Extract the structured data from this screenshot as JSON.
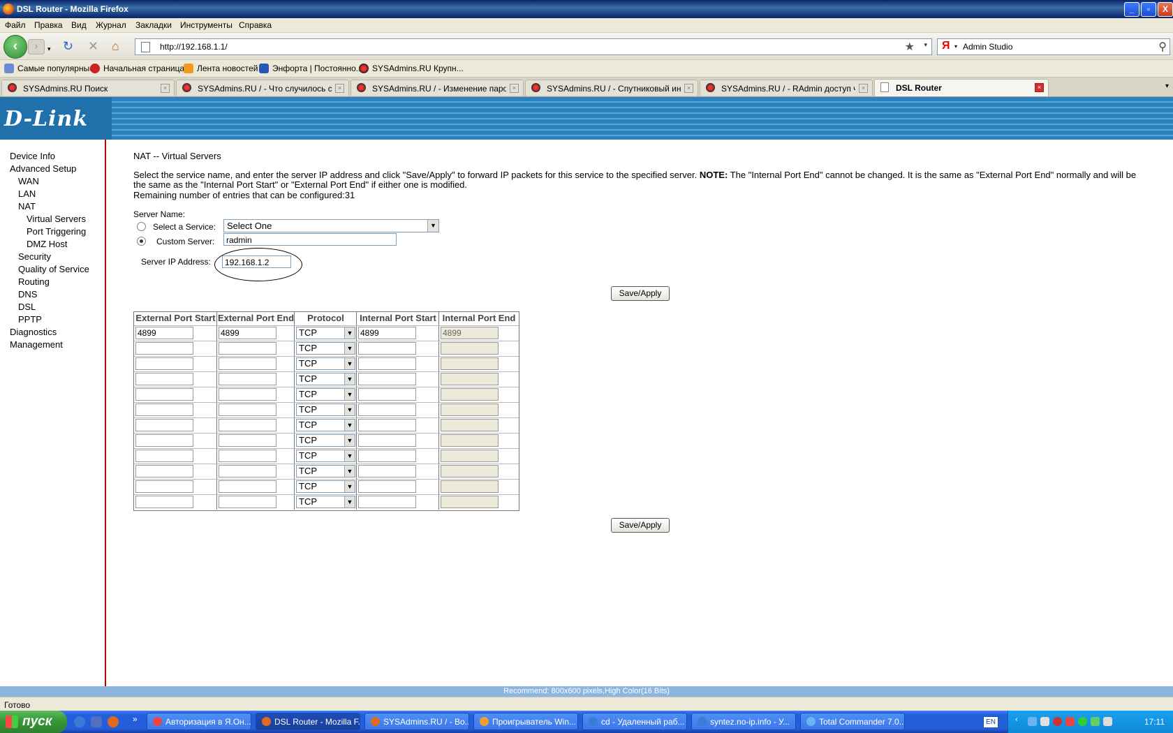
{
  "window": {
    "title": "DSL Router - Mozilla Firefox",
    "min": "_",
    "max": "▫",
    "close": "X"
  },
  "menu": [
    "Файл",
    "Правка",
    "Вид",
    "Журнал",
    "Закладки",
    "Инструменты",
    "Справка"
  ],
  "nav": {
    "url": "http://192.168.1.1/",
    "search_engine": "Я",
    "search_query": "Admin Studio"
  },
  "bookmarks": [
    "Самые популярные",
    "Начальная страница",
    "Лента новостей",
    "Энфорта | Постоянно...",
    "SYSAdmins.RU Крупн..."
  ],
  "tabs": [
    {
      "label": "SYSAdmins.RU Поиск",
      "active": false
    },
    {
      "label": "SYSAdmins.RU / - Что случилось с D...",
      "active": false
    },
    {
      "label": "SYSAdmins.RU / - Изменение пароля ...",
      "active": false
    },
    {
      "label": "SYSAdmins.RU / - Спутниковый интер...",
      "active": false
    },
    {
      "label": "SYSAdmins.RU / - RAdmin доступ чере...",
      "active": false
    },
    {
      "label": "DSL Router",
      "active": true
    }
  ],
  "brand": "D-Link",
  "sidebar": [
    {
      "label": "Device Info",
      "level": 0
    },
    {
      "label": "Advanced Setup",
      "level": 0
    },
    {
      "label": "WAN",
      "level": 1
    },
    {
      "label": "LAN",
      "level": 1
    },
    {
      "label": "NAT",
      "level": 1
    },
    {
      "label": "Virtual Servers",
      "level": 2
    },
    {
      "label": "Port Triggering",
      "level": 2
    },
    {
      "label": "DMZ Host",
      "level": 2
    },
    {
      "label": "Security",
      "level": 1
    },
    {
      "label": "Quality of Service",
      "level": 1
    },
    {
      "label": "Routing",
      "level": 1
    },
    {
      "label": "DNS",
      "level": 1
    },
    {
      "label": "DSL",
      "level": 1
    },
    {
      "label": "PPTP",
      "level": 1
    },
    {
      "label": "Diagnostics",
      "level": 0
    },
    {
      "label": "Management",
      "level": 0
    }
  ],
  "page": {
    "title": "NAT -- Virtual Servers",
    "intro": "Select the service name, and enter the server IP address and click \"Save/Apply\" to forward IP packets for this service to the specified server.",
    "note_label": "NOTE:",
    "note_text": "The \"Internal Port End\" cannot be changed. It is the same as \"External Port End\" normally and will be",
    "note_text2": "the same as the \"Internal Port Start\" or \"External Port End\" if either one is modified.",
    "remaining": "Remaining number of entries that can be configured:31",
    "server_name_label": "Server Name:",
    "select_service_label": "Select a Service:",
    "select_service_value": "Select One",
    "custom_server_label": "Custom Server:",
    "custom_server_value": "radmin",
    "server_ip_label": "Server IP Address:",
    "server_ip_value": "192.168.1.2",
    "save_label": "Save/Apply"
  },
  "table": {
    "headers": [
      "External Port Start",
      "External Port End",
      "Protocol",
      "Internal Port Start",
      "Internal Port End"
    ],
    "rows": [
      {
        "ext_start": "4899",
        "ext_end": "4899",
        "protocol": "TCP",
        "int_start": "4899",
        "int_end": "4899"
      },
      {
        "ext_start": "",
        "ext_end": "",
        "protocol": "TCP",
        "int_start": "",
        "int_end": ""
      },
      {
        "ext_start": "",
        "ext_end": "",
        "protocol": "TCP",
        "int_start": "",
        "int_end": ""
      },
      {
        "ext_start": "",
        "ext_end": "",
        "protocol": "TCP",
        "int_start": "",
        "int_end": ""
      },
      {
        "ext_start": "",
        "ext_end": "",
        "protocol": "TCP",
        "int_start": "",
        "int_end": ""
      },
      {
        "ext_start": "",
        "ext_end": "",
        "protocol": "TCP",
        "int_start": "",
        "int_end": ""
      },
      {
        "ext_start": "",
        "ext_end": "",
        "protocol": "TCP",
        "int_start": "",
        "int_end": ""
      },
      {
        "ext_start": "",
        "ext_end": "",
        "protocol": "TCP",
        "int_start": "",
        "int_end": ""
      },
      {
        "ext_start": "",
        "ext_end": "",
        "protocol": "TCP",
        "int_start": "",
        "int_end": ""
      },
      {
        "ext_start": "",
        "ext_end": "",
        "protocol": "TCP",
        "int_start": "",
        "int_end": ""
      },
      {
        "ext_start": "",
        "ext_end": "",
        "protocol": "TCP",
        "int_start": "",
        "int_end": ""
      },
      {
        "ext_start": "",
        "ext_end": "",
        "protocol": "TCP",
        "int_start": "",
        "int_end": ""
      }
    ]
  },
  "recommend": "Recommend: 800x600 pixels,High Color(16 Bits)",
  "status": "Готово",
  "taskbar": {
    "start_label": "пуск",
    "tasks": [
      {
        "label": "Авторизация в Я.Он...",
        "active": false
      },
      {
        "label": "DSL Router - Mozilla F...",
        "active": true
      },
      {
        "label": "SYSAdmins.RU / - Во...",
        "active": false
      },
      {
        "label": "Проигрыватель Win...",
        "active": false
      },
      {
        "label": "cd - Удаленный раб...",
        "active": false
      },
      {
        "label": "syntez.no-ip.info - У...",
        "active": false
      },
      {
        "label": "Total Commander 7.0...",
        "active": false
      }
    ],
    "lang": "EN",
    "clock": "17:11"
  }
}
